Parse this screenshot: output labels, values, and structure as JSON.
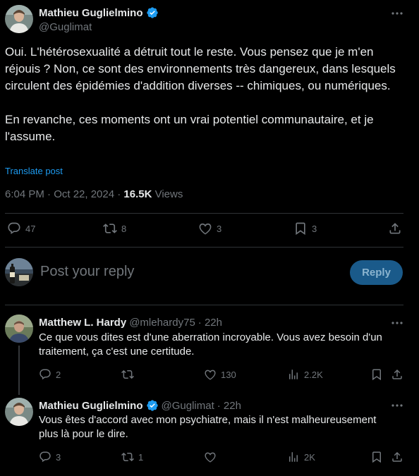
{
  "post": {
    "author_name": "Mathieu Guglielmino",
    "handle": "@Guglimat",
    "paragraph1": "Oui. L'hétérosexualité a détruit tout le reste. Vous pensez que je m'en réjouis ? Non, ce sont des environnements très dangereux, dans lesquels circulent des épidémies d'addition diverses -- chimiques, ou numériques.",
    "paragraph2": "En revanche, ces moments ont un vrai potentiel communautaire, et je l'assume.",
    "translate_label": "Translate post",
    "time": "6:04 PM · Oct 22, 2024 · ",
    "views_count": "16.5K",
    "views_label": " Views",
    "replies": "47",
    "reposts": "8",
    "likes": "3",
    "bookmarks": "3"
  },
  "composer": {
    "placeholder": "Post your reply",
    "button_label": "Reply"
  },
  "replies": [
    {
      "name": "Matthew L. Hardy",
      "handle": "@mlehardy75",
      "time": "· 22h",
      "text": "Ce que vous dites est d'une aberration incroyable. Vous avez besoin d'un traitement, ça c'est une certitude.",
      "replies": "2",
      "reposts": "",
      "likes": "130",
      "views": "2.2K"
    },
    {
      "name": "Mathieu Guglielmino",
      "handle": "@Guglimat",
      "time": "· 22h",
      "text": "Vous êtes d'accord avec mon psychiatre, mais il n'est malheureusement plus là pour le dire.",
      "replies": "3",
      "reposts": "1",
      "likes": "",
      "views": "2K"
    }
  ],
  "colors": {
    "background": "#000000",
    "text": "#e7e9ea",
    "muted": "#71767b",
    "link": "#1d9bf0",
    "verified": "#1d9bf0",
    "divider": "#2f3336"
  }
}
